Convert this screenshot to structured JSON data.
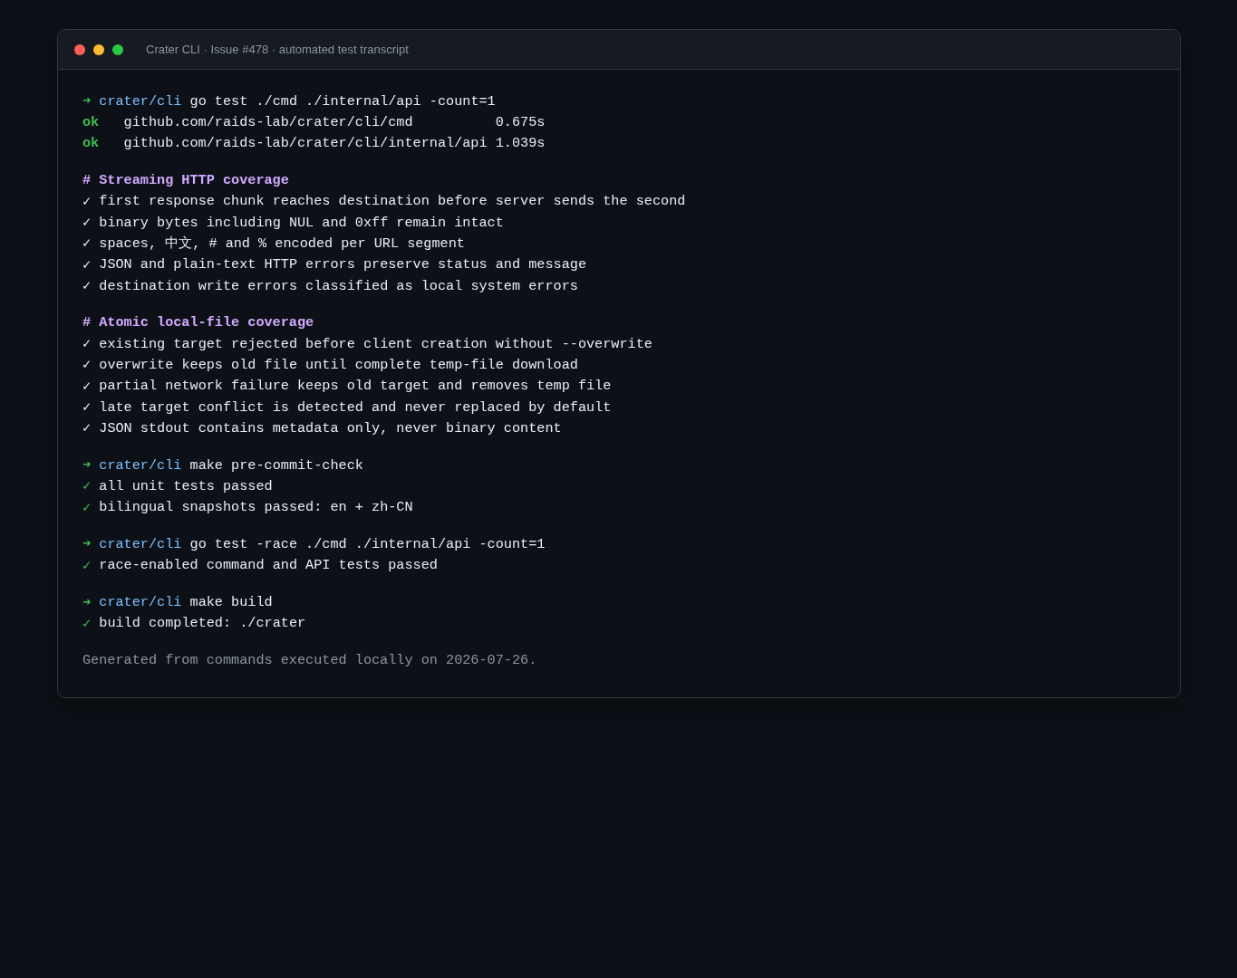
{
  "window": {
    "title": "Crater CLI · Issue #478 · automated test transcript"
  },
  "blocks": [
    {
      "lines": [
        {
          "kind": "prompt",
          "marker": "➜",
          "path": "crater/cli",
          "command": "go test ./cmd ./internal/api -count=1"
        },
        {
          "kind": "ok",
          "status": "ok",
          "package": "github.com/raids-lab/crater/cli/cmd",
          "time": "0.675s"
        },
        {
          "kind": "ok",
          "status": "ok",
          "package": "github.com/raids-lab/crater/cli/internal/api",
          "time": "1.039s"
        }
      ]
    },
    {
      "lines": [
        {
          "kind": "heading",
          "text": "# Streaming HTTP coverage"
        },
        {
          "kind": "check",
          "mark": "✓",
          "text": "first response chunk reaches destination before server sends the second"
        },
        {
          "kind": "check",
          "mark": "✓",
          "text": "binary bytes including NUL and 0xff remain intact"
        },
        {
          "kind": "check",
          "mark": "✓",
          "text": "spaces, 中文, # and % encoded per URL segment"
        },
        {
          "kind": "check",
          "mark": "✓",
          "text": "JSON and plain-text HTTP errors preserve status and message"
        },
        {
          "kind": "check",
          "mark": "✓",
          "text": "destination write errors classified as local system errors"
        }
      ]
    },
    {
      "lines": [
        {
          "kind": "heading",
          "text": "# Atomic local-file coverage"
        },
        {
          "kind": "check",
          "mark": "✓",
          "text": "existing target rejected before client creation without --overwrite"
        },
        {
          "kind": "check",
          "mark": "✓",
          "text": "overwrite keeps old file until complete temp-file download"
        },
        {
          "kind": "check",
          "mark": "✓",
          "text": "partial network failure keeps old target and removes temp file"
        },
        {
          "kind": "check",
          "mark": "✓",
          "text": "late target conflict is detected and never replaced by default"
        },
        {
          "kind": "check",
          "mark": "✓",
          "text": "JSON stdout contains metadata only, never binary content"
        }
      ]
    },
    {
      "lines": [
        {
          "kind": "prompt",
          "marker": "➜",
          "path": "crater/cli",
          "command": "make pre-commit-check"
        },
        {
          "kind": "pass",
          "mark": "✓",
          "text": "all unit tests passed"
        },
        {
          "kind": "pass",
          "mark": "✓",
          "text": "bilingual snapshots passed: en + zh-CN"
        }
      ]
    },
    {
      "lines": [
        {
          "kind": "prompt",
          "marker": "➜",
          "path": "crater/cli",
          "command": "go test -race ./cmd ./internal/api -count=1"
        },
        {
          "kind": "pass",
          "mark": "✓",
          "text": "race-enabled command and API tests passed"
        }
      ]
    },
    {
      "lines": [
        {
          "kind": "prompt",
          "marker": "➜",
          "path": "crater/cli",
          "command": "make build"
        },
        {
          "kind": "pass",
          "mark": "✓",
          "text": "build completed: ./crater"
        }
      ]
    }
  ],
  "footer": "Generated from commands executed locally on 2026-07-26."
}
